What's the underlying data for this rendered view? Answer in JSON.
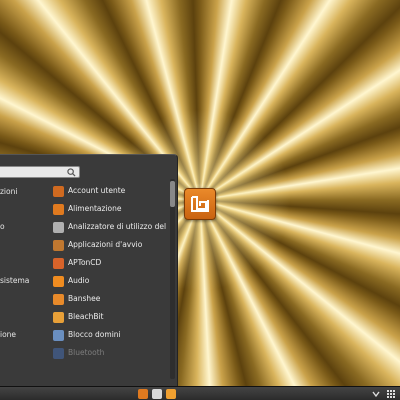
{
  "menu": {
    "search": {
      "value": "",
      "placeholder": ""
    },
    "categories": [
      {
        "label": "zioni"
      },
      {
        "label": "o"
      },
      {
        "label": "sistema"
      },
      {
        "label": "ione"
      }
    ],
    "apps": [
      {
        "label": "Account utente",
        "icon": "account-users-icon",
        "color": "#d06a20"
      },
      {
        "label": "Alimentazione",
        "icon": "power-icon",
        "color": "#e07a1f"
      },
      {
        "label": "Analizzatore di utilizzo del dis",
        "icon": "disk-analyzer-icon",
        "color": "#b0b0b0"
      },
      {
        "label": "Applicazioni d'avvio",
        "icon": "startup-apps-icon",
        "color": "#c07830"
      },
      {
        "label": "APTonCD",
        "icon": "aptoncd-icon",
        "color": "#d8632a"
      },
      {
        "label": "Audio",
        "icon": "audio-icon",
        "color": "#f08c20"
      },
      {
        "label": "Banshee",
        "icon": "banshee-icon",
        "color": "#e88a2a"
      },
      {
        "label": "BleachBit",
        "icon": "bleachbit-icon",
        "color": "#e8a038"
      },
      {
        "label": "Blocco domini",
        "icon": "domain-block-icon",
        "color": "#6a8fc0"
      },
      {
        "label": "Bluetooth",
        "icon": "bluetooth-icon",
        "color": "#4a78c8"
      }
    ]
  },
  "colors": {
    "menu_bg": "#3a3a3a",
    "panel_bg": "#2b2b2b",
    "mint_orange": "#e07a1f"
  },
  "panel": {
    "launchers": [
      {
        "name": "mintmenu-launcher-icon",
        "color": "#e07a1f"
      },
      {
        "name": "terminal-launcher-icon",
        "color": "#d9d9d9"
      },
      {
        "name": "files-launcher-icon",
        "color": "#f0a030"
      }
    ]
  }
}
